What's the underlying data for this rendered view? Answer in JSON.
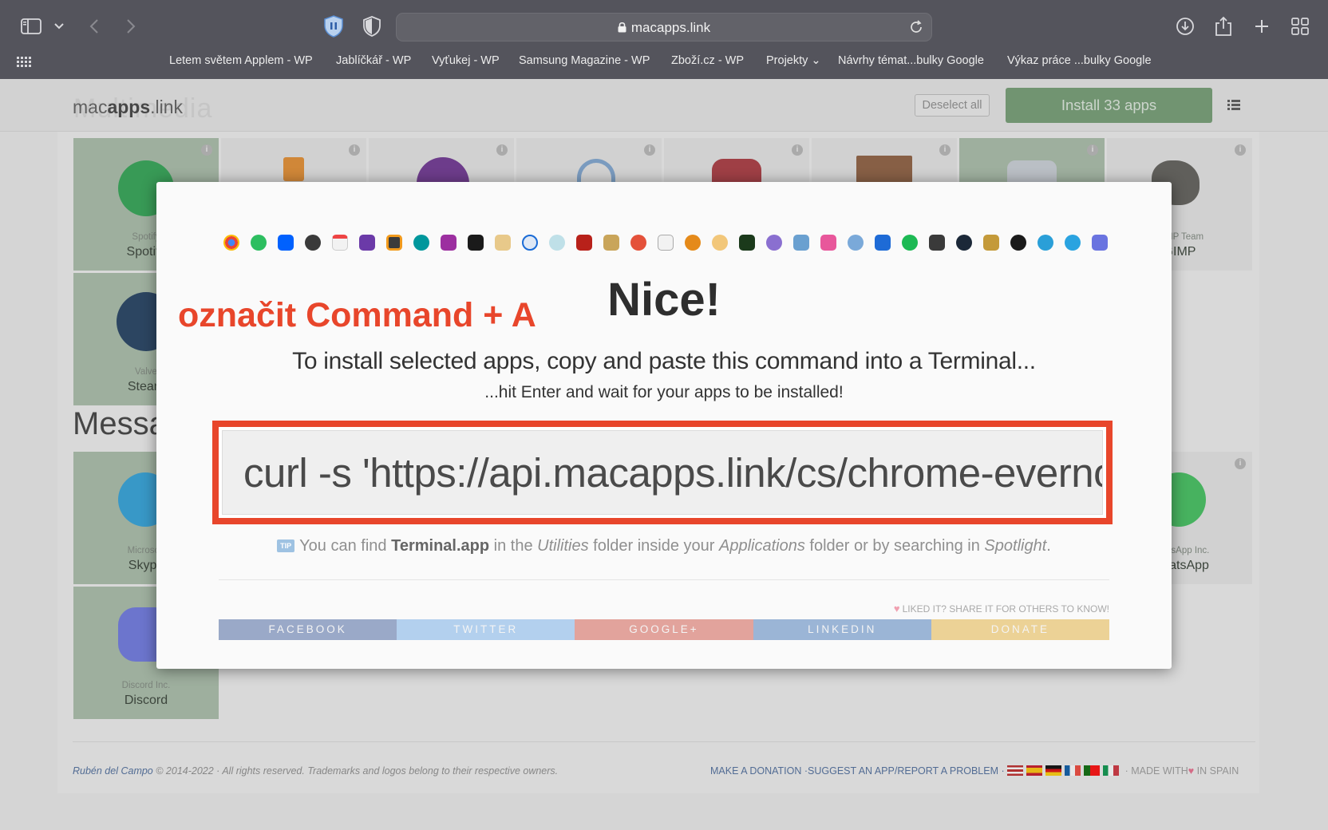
{
  "browser": {
    "url": "macapps.link",
    "bookmarks": [
      "Letem světem Applem - WP",
      "Jablíčkář - WP",
      "Vyťukej - WP",
      "Samsung Magazine - WP",
      "Zboží.cz - WP",
      "Projekty",
      "Návrhy témat...bulky Google",
      "Výkaz práce ...bulky Google"
    ]
  },
  "site": {
    "logo_light": "mac",
    "logo_bold": "apps",
    "logo_tail": ".link",
    "logo_ghost": "Multimedia",
    "deselect_label": "Deselect all",
    "install_label": "Install 33 apps",
    "tiles": [
      {
        "category": "Spotify",
        "name": "Spotify"
      },
      {
        "category": "GIMP Team",
        "name": "GIMP"
      },
      {
        "category": "Valve",
        "name": "Steam"
      },
      {
        "category": "Microsoft",
        "name": "Skype"
      },
      {
        "category": "WhatsApp Inc.",
        "name": "WhatsApp"
      },
      {
        "category": "Discord Inc.",
        "name": "Discord"
      }
    ],
    "section_title": "Messaging",
    "footer_author": "Rubén del Campo",
    "footer_rights": " © 2014-2022 · All rights reserved. Trademarks and logos belong to their respective owners.",
    "footer_donation": "MAKE A DONATION",
    "footer_suggest": "·SUGGEST AN APP/REPORT A PROBLEM ·",
    "footer_made": "· MADE WITH",
    "footer_spain": " IN SPAIN"
  },
  "modal": {
    "annotation": "označit Command + A",
    "title": "Nice!",
    "subtitle": "To install selected apps, copy and paste this command into a Terminal...",
    "subtitle2": "...hit Enter and wait for your apps to be installed!",
    "command": "curl -s 'https://api.macapps.link/cs/chrome-evernote-dropbox-alfred-fantastical-github-sublime-arduino-itsycal-iterm-theunarchiver-1password-cyberduck-filezilla-keka-appcleaner-textedit-quicksilver-amphetamine-vlc'",
    "tip_badge": "TIP",
    "tip_pre": "You can find ",
    "tip_app": "Terminal.app",
    "tip_mid1": " in the ",
    "tip_utilities": "Utilities",
    "tip_mid2": " folder inside your ",
    "tip_applications": "Applications",
    "tip_mid3": " folder or by searching in ",
    "tip_spotlight": "Spotlight",
    "tip_end": ".",
    "liked": "LIKED IT? SHARE IT FOR OTHERS TO KNOW!",
    "share": [
      "FACEBOOK",
      "TWITTER",
      "GOOGLE+",
      "LINKEDIN",
      "DONATE"
    ]
  },
  "colors": {
    "annotation_red": "#e8462b",
    "install_green": "#6f9a6f",
    "share_facebook": "#9aa9c8",
    "share_twitter": "#b3d0ee",
    "share_google": "#e2a39c",
    "share_linkedin": "#9bb5d6",
    "share_donate": "#ecd296"
  }
}
